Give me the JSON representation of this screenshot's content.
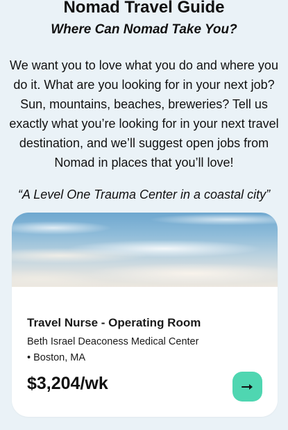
{
  "header": {
    "title": "Nomad Travel Guide",
    "subtitle": "Where Can Nomad Take You?"
  },
  "intro": {
    "text": "We want you to love what you do and where you do it. What are you looking for in your next job? Sun, mountains, beaches, breweries? Tell us exactly what you’re looking for in your next travel destination, and we’ll suggest open jobs from Nomad in places that you’ll love!"
  },
  "quote": {
    "text": "“A Level One Trauma Center in a coastal city”"
  },
  "job_card": {
    "image_icon": "sky-clouds-photo",
    "title": "Travel Nurse - Operating Room",
    "facility": "Beth Israel Deaconess Medical Center",
    "bullet": "•",
    "location": "Boston, MA",
    "pay": "$3,204/wk",
    "action_icon": "arrow-right-icon"
  },
  "colors": {
    "background": "#eaf2f7",
    "card": "#ffffff",
    "accent": "#4fd6b1",
    "text": "#111111"
  }
}
